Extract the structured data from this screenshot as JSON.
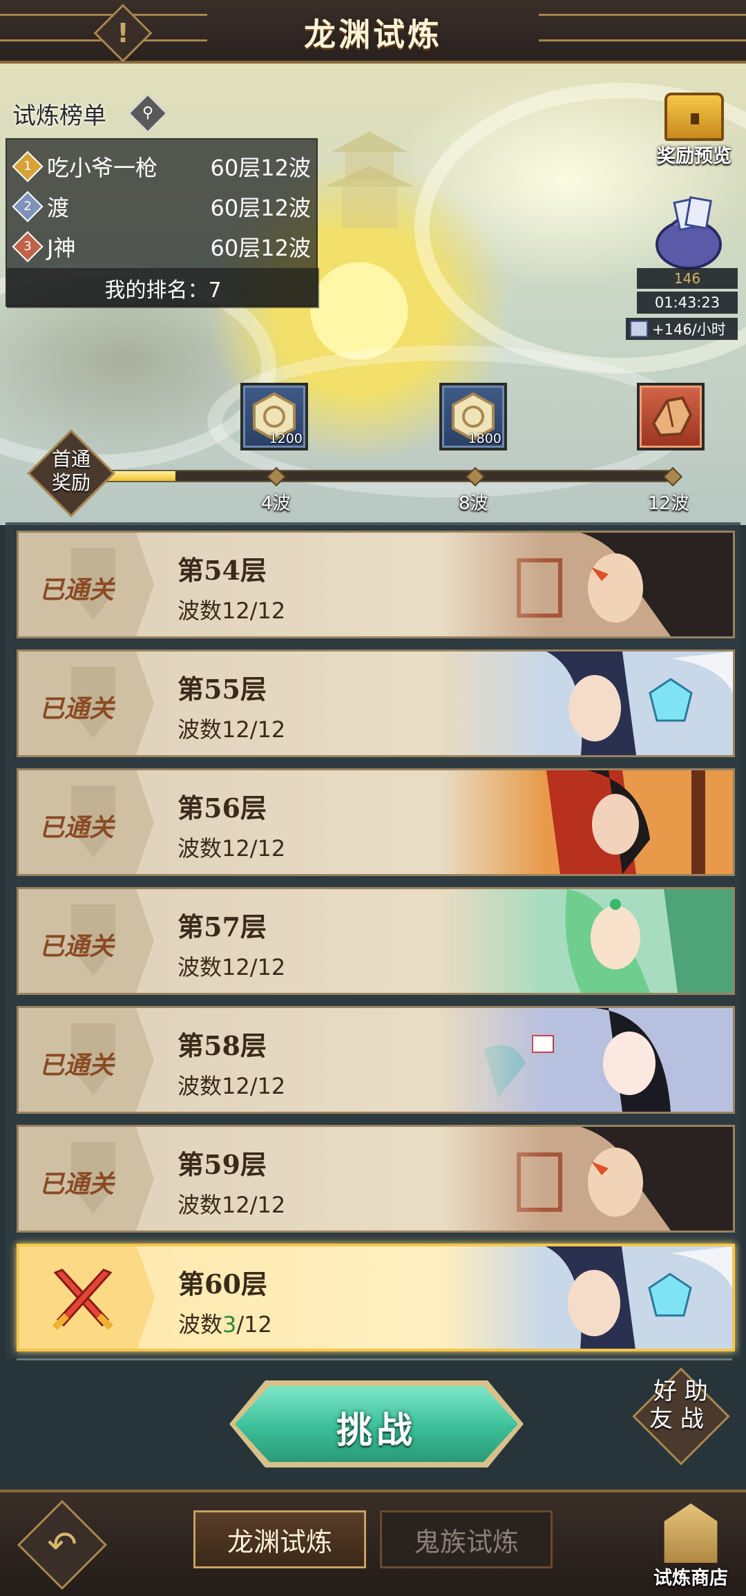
{
  "header": {
    "title": "龙渊试炼",
    "alert_icon": "!"
  },
  "leaderboard": {
    "title": "试炼榜单",
    "entries": [
      {
        "rank": "1",
        "name": "吃小爷一枪",
        "score": "60层12波",
        "medal_color": "#d8a238"
      },
      {
        "rank": "2",
        "name": "渡",
        "score": "60层12波",
        "medal_color": "#7f93b8"
      },
      {
        "rank": "3",
        "name": "J神",
        "score": "60层12波",
        "medal_color": "#c0634a"
      }
    ],
    "my_rank_label": "我的排名：7"
  },
  "side_widgets": {
    "reward_preview_label": "奖励预览",
    "bag_count": "146",
    "bag_timer": "01:43:23",
    "bag_rate": "+146/小时"
  },
  "first_clear": {
    "label_line1": "首通",
    "label_line2": "奖励",
    "progress_fraction": 0.155,
    "rewards": [
      {
        "quantity": "1200",
        "style": "blue",
        "icon": "jade-token-icon"
      },
      {
        "quantity": "1800",
        "style": "blue",
        "icon": "jade-token-icon"
      },
      {
        "quantity": "",
        "style": "red",
        "icon": "ore-stone-icon"
      }
    ],
    "wave_markers": [
      "4波",
      "8波",
      "12波"
    ]
  },
  "levels": [
    {
      "status": "已通关",
      "name": "第54层",
      "waves_label": "波数",
      "waves_current": "12",
      "waves_total": "/12",
      "active": false
    },
    {
      "status": "已通关",
      "name": "第55层",
      "waves_label": "波数",
      "waves_current": "12",
      "waves_total": "/12",
      "active": false
    },
    {
      "status": "已通关",
      "name": "第56层",
      "waves_label": "波数",
      "waves_current": "12",
      "waves_total": "/12",
      "active": false
    },
    {
      "status": "已通关",
      "name": "第57层",
      "waves_label": "波数",
      "waves_current": "12",
      "waves_total": "/12",
      "active": false
    },
    {
      "status": "已通关",
      "name": "第58层",
      "waves_label": "波数",
      "waves_current": "12",
      "waves_total": "/12",
      "active": false
    },
    {
      "status": "已通关",
      "name": "第59层",
      "waves_label": "波数",
      "waves_current": "12",
      "waves_total": "/12",
      "active": false
    },
    {
      "status": "",
      "name": "第60层",
      "waves_label": "波数",
      "waves_current": "3",
      "waves_total": "/12",
      "active": true
    }
  ],
  "actions": {
    "challenge_label": "挑战",
    "friend_assist_line1": "好 助",
    "friend_assist_line2": "友 战"
  },
  "bottom_bar": {
    "tab_active": "龙渊试炼",
    "tab_inactive": "鬼族试炼",
    "shop_label": "试炼商店",
    "back_icon": "↶"
  },
  "colors": {
    "accent_gold": "#a8874e",
    "challenge_teal": "#3bbf98",
    "progress_yellow": "#f0c330",
    "current_wave_green": "#2e8a3a"
  }
}
